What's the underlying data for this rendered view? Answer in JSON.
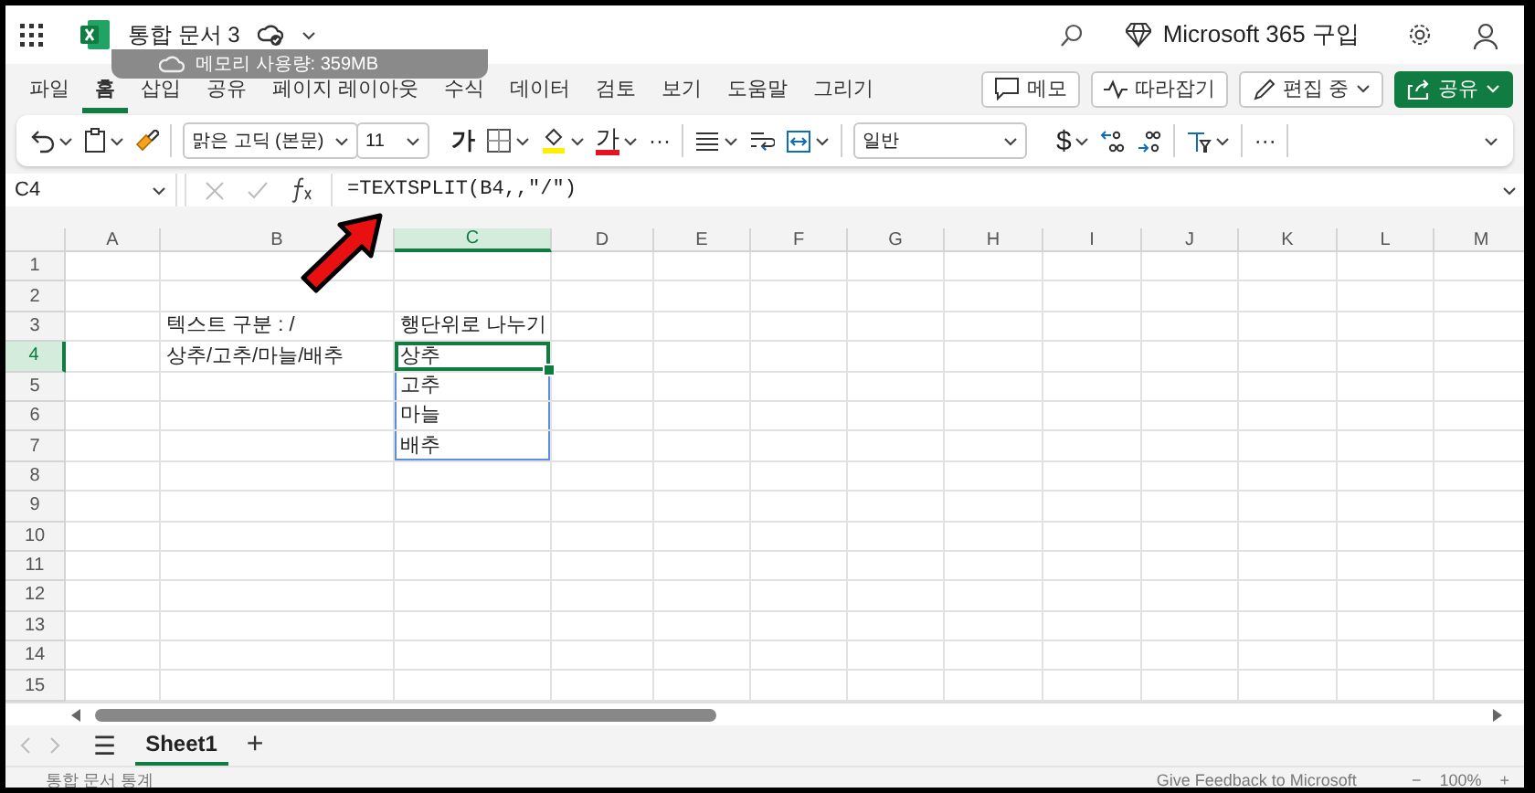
{
  "title_bar": {
    "document_title": "통합 문서 3",
    "tooltip": "메모리 사용량: 359MB",
    "buy_label": "Microsoft 365 구입"
  },
  "tabs": [
    {
      "label": "파일",
      "selected": false
    },
    {
      "label": "홈",
      "selected": true
    },
    {
      "label": "삽입",
      "selected": false
    },
    {
      "label": "공유",
      "selected": false
    },
    {
      "label": "페이지 레이아웃",
      "selected": false
    },
    {
      "label": "수식",
      "selected": false
    },
    {
      "label": "데이터",
      "selected": false
    },
    {
      "label": "검토",
      "selected": false
    },
    {
      "label": "보기",
      "selected": false
    },
    {
      "label": "도움말",
      "selected": false
    },
    {
      "label": "그리기",
      "selected": false
    }
  ],
  "ribbon_buttons": [
    {
      "kind": "comment",
      "label": "메모"
    },
    {
      "kind": "catchup",
      "label": "따라잡기"
    },
    {
      "kind": "editing",
      "label": "편집 중"
    },
    {
      "kind": "share",
      "label": "공유"
    }
  ],
  "toolbar": {
    "font": "맑은 고딕 (본문)",
    "size": "11",
    "bold": "가",
    "font_color": "가",
    "more": "···",
    "number_format": "일반",
    "currency": "$",
    "more_2": "···"
  },
  "formula_bar": {
    "name_box": "C4",
    "formula": "=TEXTSPLIT(B4,,\"/\")"
  },
  "sheet": {
    "columns": [
      {
        "label": "A",
        "selected": false
      },
      {
        "label": "B",
        "selected": false
      },
      {
        "label": "C",
        "selected": true
      },
      {
        "label": "D",
        "selected": false
      },
      {
        "label": "E",
        "selected": false
      },
      {
        "label": "F",
        "selected": false
      },
      {
        "label": "G",
        "selected": false
      },
      {
        "label": "H",
        "selected": false
      },
      {
        "label": "I",
        "selected": false
      },
      {
        "label": "J",
        "selected": false
      },
      {
        "label": "K",
        "selected": false
      },
      {
        "label": "L",
        "selected": false
      },
      {
        "label": "M",
        "selected": false
      }
    ],
    "rows": [
      {
        "label": "1",
        "selected": false,
        "cells": []
      },
      {
        "label": "2",
        "selected": false,
        "cells": []
      },
      {
        "label": "3",
        "selected": false,
        "cells": [
          null,
          {
            "text": "텍스트 구분 : /",
            "active": false,
            "spill": false
          },
          {
            "text": "행단위로 나누기",
            "active": false,
            "spill": false
          }
        ]
      },
      {
        "label": "4",
        "selected": true,
        "cells": [
          null,
          {
            "text": "상추/고추/마늘/배추",
            "active": false,
            "spill": false
          },
          {
            "text": "상추",
            "active": true,
            "spill": true
          }
        ]
      },
      {
        "label": "5",
        "selected": false,
        "cells": [
          null,
          null,
          {
            "text": "고추",
            "active": false,
            "spill": true
          }
        ]
      },
      {
        "label": "6",
        "selected": false,
        "cells": [
          null,
          null,
          {
            "text": "마늘",
            "active": false,
            "spill": true
          }
        ]
      },
      {
        "label": "7",
        "selected": false,
        "cells": [
          null,
          null,
          {
            "text": "배추",
            "active": false,
            "spill": true
          }
        ]
      },
      {
        "label": "8",
        "selected": false,
        "cells": []
      },
      {
        "label": "9",
        "selected": false,
        "cells": []
      },
      {
        "label": "10",
        "selected": false,
        "cells": []
      },
      {
        "label": "11",
        "selected": false,
        "cells": []
      },
      {
        "label": "12",
        "selected": false,
        "cells": []
      },
      {
        "label": "13",
        "selected": false,
        "cells": []
      },
      {
        "label": "14",
        "selected": false,
        "cells": []
      },
      {
        "label": "15",
        "selected": false,
        "cells": []
      }
    ]
  },
  "sheet_tabs": {
    "menu": "☰",
    "tabs": [
      {
        "label": "Sheet1",
        "selected": true
      }
    ],
    "add": "+"
  },
  "status_bar": {
    "left": "통합 문서 통계",
    "feedback": "Give Feedback to Microsoft",
    "zoom_out": "−",
    "zoom": "100%",
    "zoom_in": "+"
  }
}
